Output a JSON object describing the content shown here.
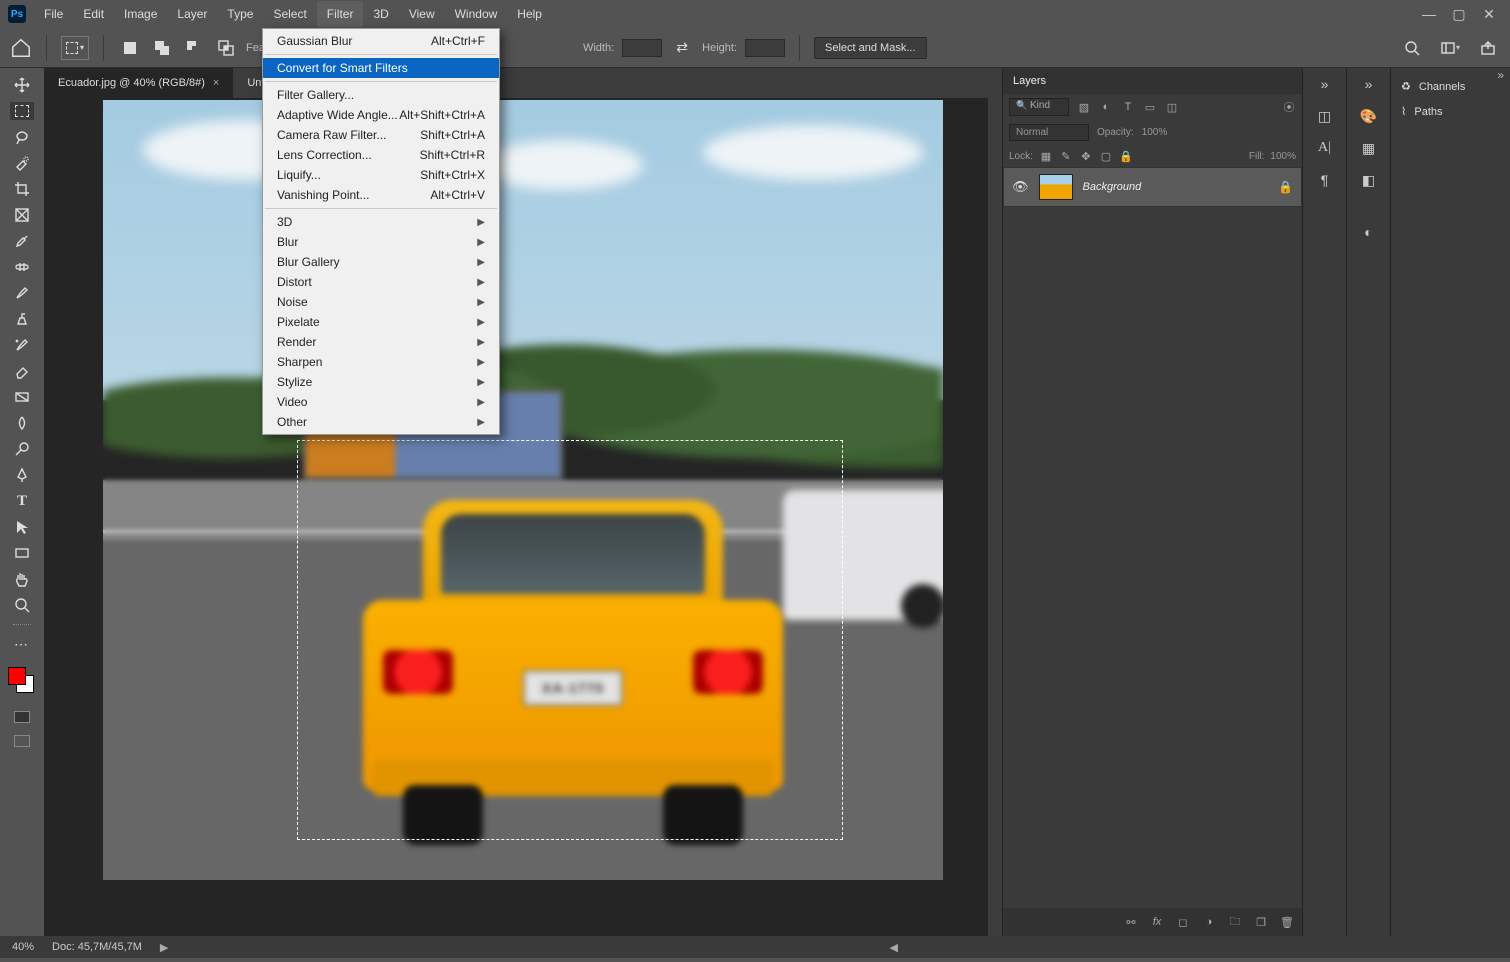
{
  "menubar": {
    "items": [
      "File",
      "Edit",
      "Image",
      "Layer",
      "Type",
      "Select",
      "Filter",
      "3D",
      "View",
      "Window",
      "Help"
    ],
    "open_index": 6
  },
  "optionbar": {
    "feather_label": "Feather:",
    "width_label": "Width:",
    "swap_label": "",
    "height_label": "Height:",
    "select_mask_btn": "Select and Mask..."
  },
  "tabs": [
    {
      "label": "Ecuador.jpg @ 40% (RGB/8#)",
      "active": true
    },
    {
      "label": "Untitled",
      "active": false
    }
  ],
  "statusbar": {
    "zoom": "40%",
    "doc": "Doc: 45,7M/45,7M"
  },
  "layers_panel": {
    "title": "Layers",
    "kind": "Kind",
    "blend": "Normal",
    "opacity_label": "Opacity:",
    "opacity_val": "100%",
    "lock_label": "Lock:",
    "fill_label": "Fill:",
    "fill_val": "100%",
    "layer": {
      "name": "Background"
    }
  },
  "right_far_panels": {
    "channels": "Channels",
    "paths": "Paths"
  },
  "filter_menu": {
    "items": [
      {
        "label": "Gaussian Blur",
        "shortcut": "Alt+Ctrl+F"
      },
      {
        "sep": true
      },
      {
        "label": "Convert for Smart Filters",
        "hover": true
      },
      {
        "sep": true
      },
      {
        "label": "Filter Gallery..."
      },
      {
        "label": "Adaptive Wide Angle...",
        "shortcut": "Alt+Shift+Ctrl+A"
      },
      {
        "label": "Camera Raw Filter...",
        "shortcut": "Shift+Ctrl+A"
      },
      {
        "label": "Lens Correction...",
        "shortcut": "Shift+Ctrl+R"
      },
      {
        "label": "Liquify...",
        "shortcut": "Shift+Ctrl+X"
      },
      {
        "label": "Vanishing Point...",
        "shortcut": "Alt+Ctrl+V"
      },
      {
        "sep": true
      },
      {
        "label": "3D",
        "sub": true
      },
      {
        "label": "Blur",
        "sub": true
      },
      {
        "label": "Blur Gallery",
        "sub": true
      },
      {
        "label": "Distort",
        "sub": true
      },
      {
        "label": "Noise",
        "sub": true
      },
      {
        "label": "Pixelate",
        "sub": true
      },
      {
        "label": "Render",
        "sub": true
      },
      {
        "label": "Sharpen",
        "sub": true
      },
      {
        "label": "Stylize",
        "sub": true
      },
      {
        "label": "Video",
        "sub": true
      },
      {
        "label": "Other",
        "sub": true
      }
    ]
  },
  "canvas": {
    "plate": "XA-1770"
  }
}
